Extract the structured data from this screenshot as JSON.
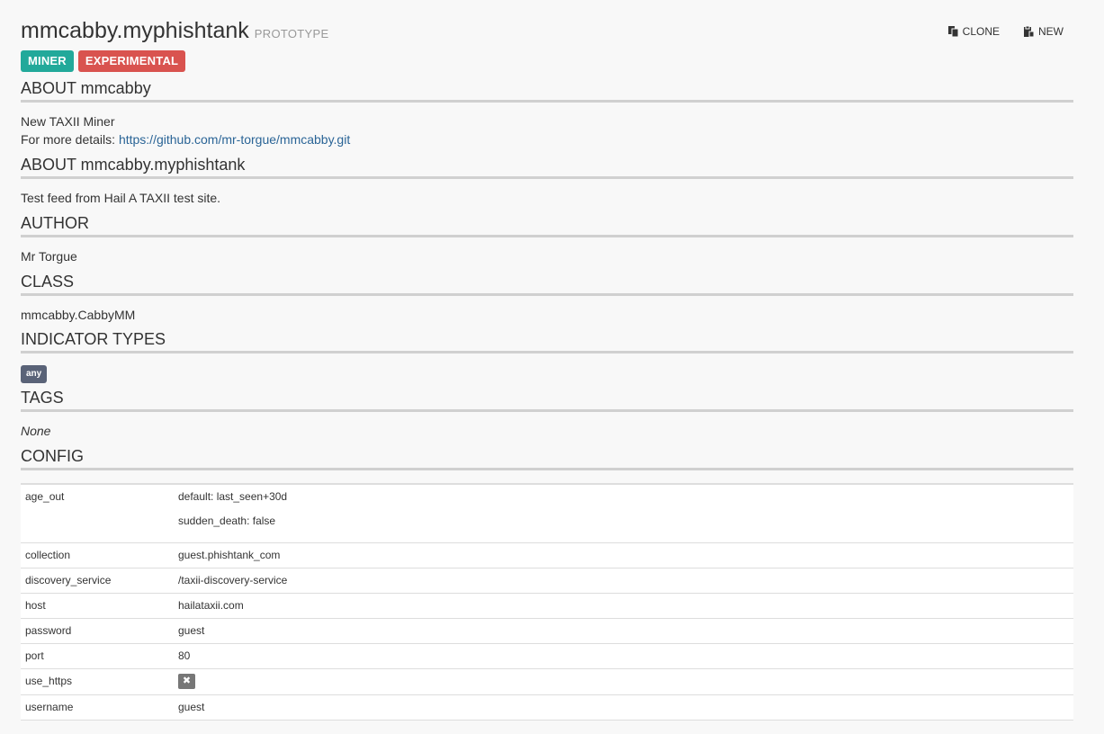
{
  "header": {
    "title": "mmcabby.myphishtank",
    "status": "PROTOTYPE",
    "actions": [
      {
        "label": "CLONE",
        "icon": "clone-icon"
      },
      {
        "label": "NEW",
        "icon": "new-icon"
      }
    ]
  },
  "badges": [
    {
      "label": "MINER",
      "color": "#22a99a"
    },
    {
      "label": "EXPERIMENTAL",
      "color": "#d9534f"
    }
  ],
  "sections": {
    "about_package": {
      "heading": "ABOUT mmcabby",
      "line1": "New TAXII Miner",
      "details_prefix": "For more details: ",
      "details_link": "https://github.com/mr-torgue/mmcabby.git"
    },
    "about_prototype": {
      "heading": "ABOUT mmcabby.myphishtank",
      "text": "Test feed from Hail A TAXII test site."
    },
    "author": {
      "heading": "AUTHOR",
      "text": "Mr Torgue"
    },
    "class": {
      "heading": "CLASS",
      "text": "mmcabby.CabbyMM"
    },
    "indicator_types": {
      "heading": "INDICATOR TYPES",
      "types": [
        "any"
      ]
    },
    "tags": {
      "heading": "TAGS",
      "text": "None"
    },
    "config": {
      "heading": "CONFIG"
    }
  },
  "config_rows": [
    {
      "key": "age_out",
      "values": [
        "default: last_seen+30d",
        "sudden_death: false"
      ]
    },
    {
      "key": "collection",
      "values": [
        "guest.phishtank_com"
      ]
    },
    {
      "key": "discovery_service",
      "values": [
        "/taxii-discovery-service"
      ]
    },
    {
      "key": "host",
      "values": [
        "hailataxii.com"
      ]
    },
    {
      "key": "password",
      "values": [
        "guest"
      ]
    },
    {
      "key": "port",
      "values": [
        "80"
      ]
    },
    {
      "key": "use_https",
      "values": [],
      "checkbox": false,
      "icon": "x-icon"
    },
    {
      "key": "username",
      "values": [
        "guest"
      ]
    }
  ]
}
